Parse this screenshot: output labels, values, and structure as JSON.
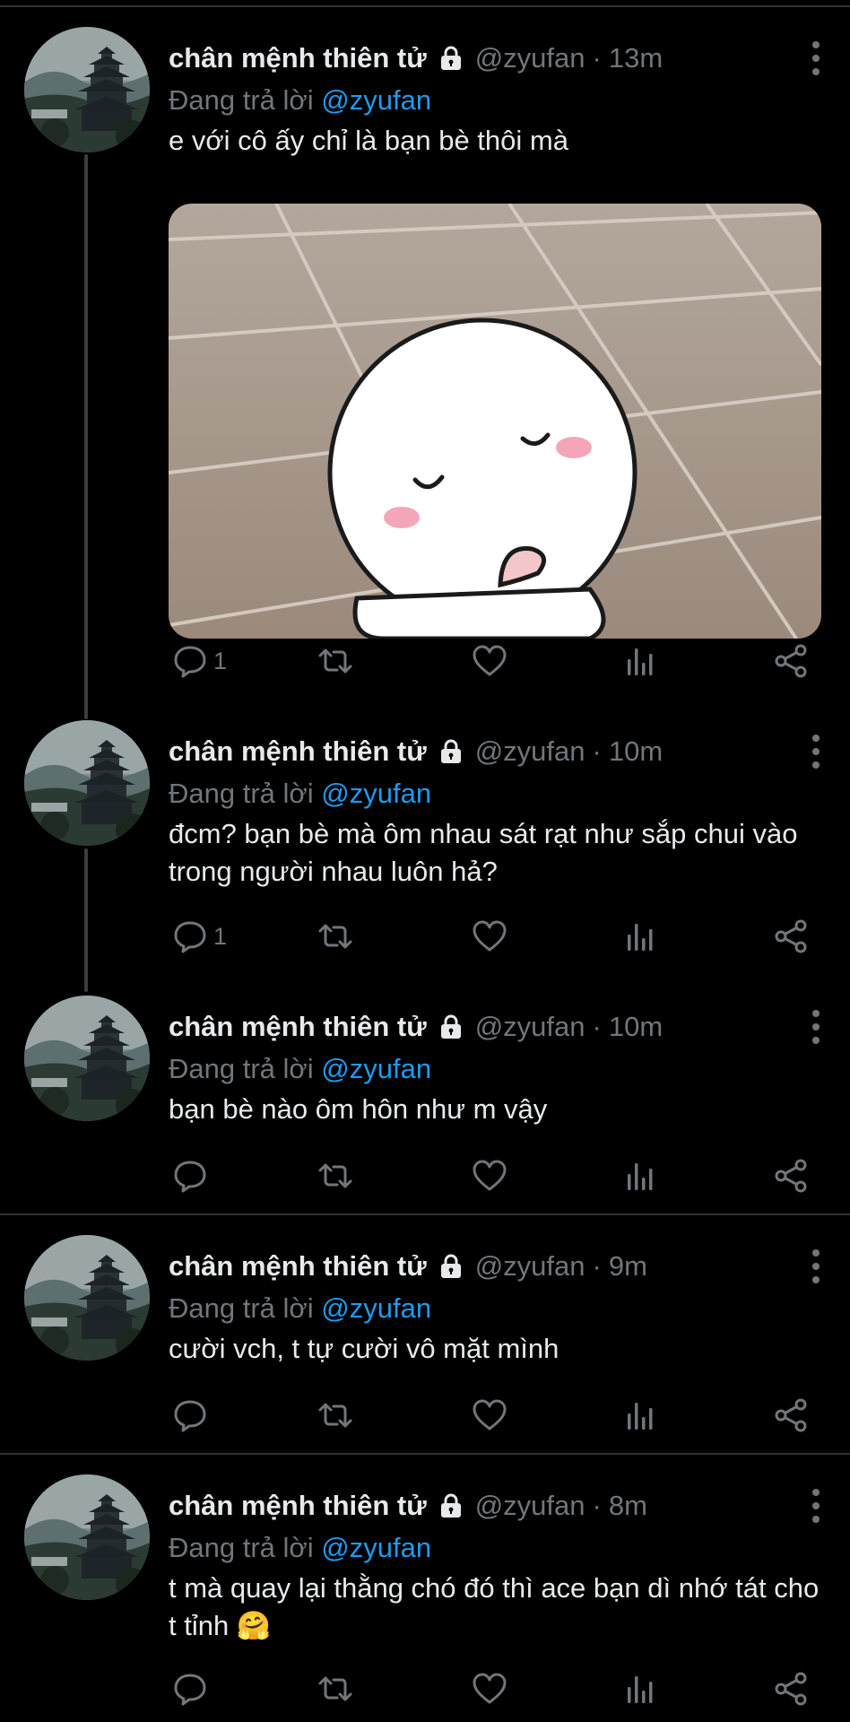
{
  "colors": {
    "background": "#000000",
    "text": "#e7e9ea",
    "muted": "#71767b",
    "accent": "#1d9bf0",
    "divider": "#2f3336"
  },
  "icons": {
    "avatar": "pagoda-avatar",
    "lock": "lock-icon",
    "more": "more-vertical-icon",
    "reply": "reply-icon",
    "retweet": "retweet-icon",
    "like": "heart-icon",
    "views": "views-icon",
    "share": "share-icon"
  },
  "tweets": [
    {
      "name": "chân mệnh thiên tử",
      "handle": "@zyufan",
      "sep": "·",
      "time": "13m",
      "reply_prefix": "Đang trả lời",
      "reply_to": "@zyufan",
      "text": "e với cô ấy chỉ là bạn bè thôi mà",
      "reply_count": "1",
      "has_media": true
    },
    {
      "name": "chân mệnh thiên tử",
      "handle": "@zyufan",
      "sep": "·",
      "time": "10m",
      "reply_prefix": "Đang trả lời",
      "reply_to": "@zyufan",
      "text": "đcm? bạn bè mà ôm nhau sát rạt như sắp chui vào trong người nhau luôn hả?",
      "reply_count": "1"
    },
    {
      "name": "chân mệnh thiên tử",
      "handle": "@zyufan",
      "sep": "·",
      "time": "10m",
      "reply_prefix": "Đang trả lời",
      "reply_to": "@zyufan",
      "text": "bạn bè nào ôm hôn như m vậy",
      "reply_count": ""
    },
    {
      "name": "chân mệnh thiên tử",
      "handle": "@zyufan",
      "sep": "·",
      "time": "9m",
      "reply_prefix": "Đang trả lời",
      "reply_to": "@zyufan",
      "text": "cười vch, t tự cười vô mặt mình",
      "reply_count": ""
    },
    {
      "name": "chân mệnh thiên tử",
      "handle": "@zyufan",
      "sep": "·",
      "time": "8m",
      "reply_prefix": "Đang trả lời",
      "reply_to": "@zyufan",
      "text": "t mà quay lại thằng chó đó thì ace bạn dì nhớ tát cho t tỉnh 🤗",
      "reply_count": ""
    }
  ]
}
